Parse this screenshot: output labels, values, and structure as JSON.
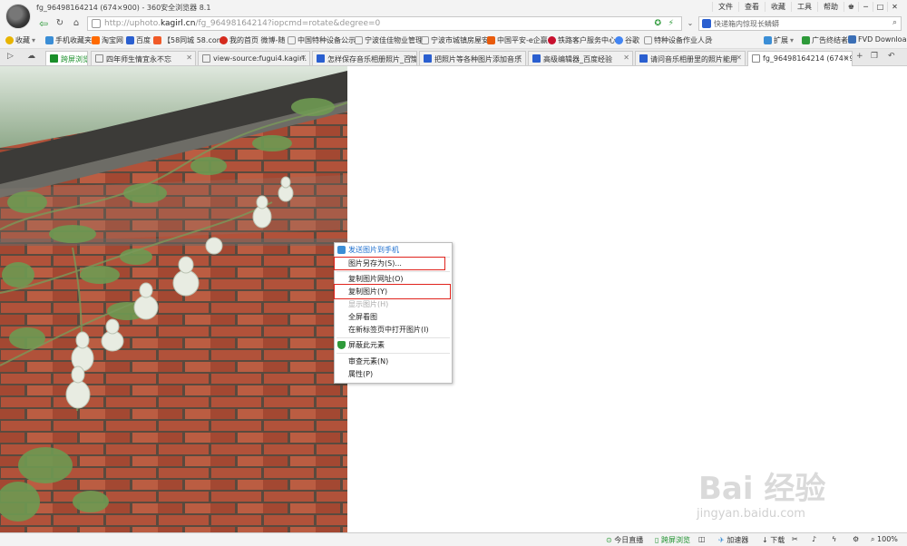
{
  "window": {
    "title": "fg_96498164214 (674×900) - 360安全浏览器 8.1",
    "menus": [
      "文件",
      "查看",
      "收藏",
      "工具",
      "帮助"
    ]
  },
  "address": {
    "url_prefix": "http://uphoto.",
    "url_domain": "kagirl.cn",
    "url_suffix": "/fg_96498164214?iopcmd=rotate&degree=0",
    "search_placeholder": "快递箱内惊现长鳞蟒"
  },
  "bookmarks": [
    {
      "label": "收藏",
      "color": "#e8b400"
    },
    {
      "label": "手机收藏夹",
      "color": "#3b8ed6"
    },
    {
      "label": "淘宝网",
      "color": "#ff6a00"
    },
    {
      "label": "百度",
      "color": "#2a5fd0"
    },
    {
      "label": "【58同城 58.com",
      "color": "#f05a28"
    },
    {
      "label": "我的首页 微博-随",
      "color": "#d52b1e"
    },
    {
      "label": "中国特种设备公示",
      "color": "#999999"
    },
    {
      "label": "宁波佳佳物业管理",
      "color": "#999999"
    },
    {
      "label": "宁波市城镇房屋安",
      "color": "#999999"
    },
    {
      "label": "中国平安-e企赢",
      "color": "#e95b0c"
    },
    {
      "label": "铁路客户服务中心",
      "color": "#c8102e"
    },
    {
      "label": "谷歌",
      "color": "#4285f4"
    },
    {
      "label": "特种设备作业人员",
      "color": "#999999"
    },
    {
      "label": "扩展",
      "color": "#3b8ed6"
    },
    {
      "label": "广告终结者",
      "color": "#2e9a3a"
    },
    {
      "label": "FVD Downloa",
      "color": "#3b6fb6"
    }
  ],
  "tabs": [
    {
      "label": "跨屏浏览",
      "type": "green"
    },
    {
      "label": "四年师生情宜永不忘",
      "type": "normal"
    },
    {
      "label": "view-source:fugui4.kagirl.",
      "type": "normal"
    },
    {
      "label": "怎样保存音乐相册照片_百度",
      "type": "normal"
    },
    {
      "label": "把照片等各种图片添加音乐",
      "type": "normal"
    },
    {
      "label": "高级编辑器_百度经验",
      "type": "normal"
    },
    {
      "label": "请问音乐相册里的照片能用",
      "type": "normal"
    },
    {
      "label": "fg_96498164214 (674×900)",
      "type": "active"
    }
  ],
  "context_menu": {
    "items": [
      {
        "label": "发送图片到手机",
        "style": "blue"
      },
      {
        "label": "图片另存为(S)...",
        "style": "highlight"
      },
      {
        "label": "复制图片网址(O)",
        "style": "normal"
      },
      {
        "label": "复制图片(Y)",
        "style": "highlight"
      },
      {
        "label": "显示图片(H)",
        "style": "disabled"
      },
      {
        "label": "全屏看图",
        "style": "normal"
      },
      {
        "label": "在新标签页中打开图片(I)",
        "style": "normal"
      },
      {
        "label": "屏蔽此元素",
        "style": "shield"
      },
      {
        "label": "审查元素(N)",
        "style": "normal"
      },
      {
        "label": "属性(P)",
        "style": "normal"
      }
    ]
  },
  "status": {
    "today_live": "今日直播",
    "cross_screen": "跨屏浏览",
    "accelerator": "加速器",
    "download": "下载",
    "zoom": "100%"
  },
  "watermark": {
    "brand": "Bai 经验",
    "domain": "jingyan.baidu.com"
  },
  "colors": {
    "accent_green": "#2e9a3a",
    "highlight_red": "#e0231c",
    "menu_blue": "#1e6fcf"
  }
}
